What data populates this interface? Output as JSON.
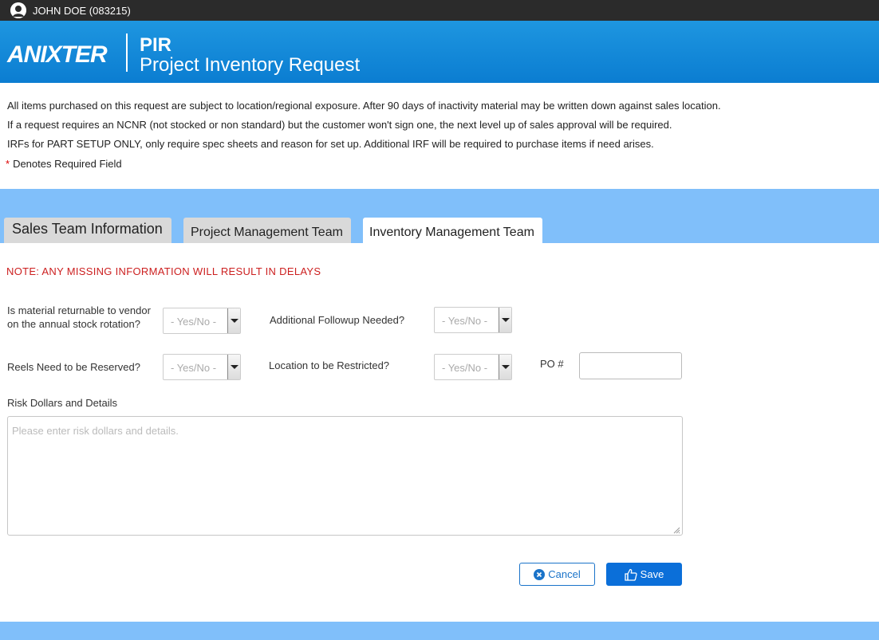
{
  "user": {
    "name": "JOHN DOE (083215)"
  },
  "header": {
    "logo": "ANIXTER",
    "app_code": "PIR",
    "app_title": "Project Inventory Request"
  },
  "info_lines": [
    "All items purchased on this request are subject to location/regional exposure.  After 90 days of inactivity material may be written down against sales location.",
    "If a request requires an NCNR (not stocked or non standard) but the customer won't sign one, the next level up of sales approval will be required.",
    "IRFs for PART SETUP ONLY, only require spec sheets and reason for set up.  Additional IRF will be required to purchase items if need arises."
  ],
  "required_note": {
    "star": "*",
    "text": "Denotes Required Field"
  },
  "tabs": [
    {
      "label": "Sales Team Information",
      "active": false
    },
    {
      "label": "Project Management Team",
      "active": false
    },
    {
      "label": "Inventory Management Team",
      "active": true
    }
  ],
  "form": {
    "note": "NOTE: ANY MISSING INFORMATION WILL RESULT IN DELAYS",
    "returnable_label": "Is material returnable to vendor on the annual stock rotation?",
    "returnable_value": "- Yes/No -",
    "followup_label": "Additional Followup Needed?",
    "followup_value": "- Yes/No -",
    "reels_label": "Reels Need to be Reserved?",
    "reels_value": "- Yes/No -",
    "restricted_label": "Location to be Restricted?",
    "restricted_value": "- Yes/No -",
    "po_label": "PO #",
    "po_value": "",
    "risk_label": "Risk Dollars and Details",
    "risk_placeholder": "Please enter risk dollars and details."
  },
  "buttons": {
    "cancel": "Cancel",
    "save": "Save"
  },
  "colors": {
    "header_blue": "#0b7dd1",
    "band_blue": "#80bffa",
    "note_red": "#cc1f1f",
    "save_blue": "#0b6fd9"
  }
}
